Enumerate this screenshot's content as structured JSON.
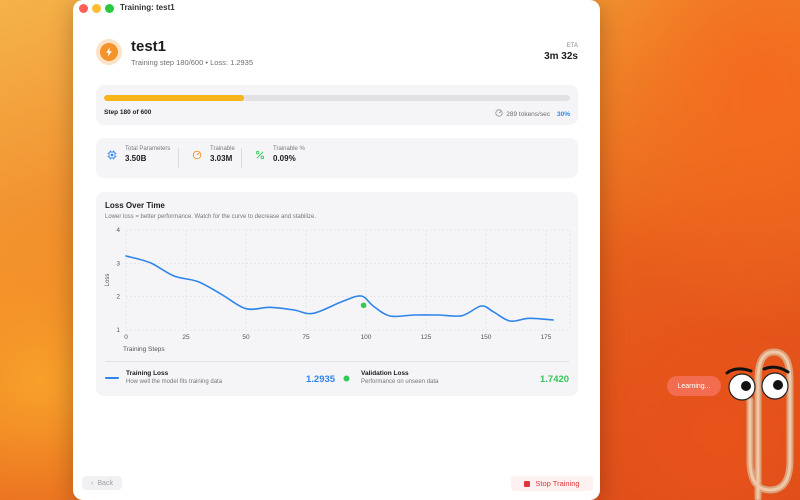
{
  "window": {
    "title": "Training: test1"
  },
  "header": {
    "name": "test1",
    "subtitle": "Training step 180/600 • Loss: 1.2935",
    "eta_label": "ETA",
    "eta_value": "3m 32s",
    "icon": "lightning-bolt-icon"
  },
  "progress": {
    "fraction": 0.3,
    "left_label": "Step 180 of 600",
    "speed": "289 tokens/sec",
    "percent": "30%",
    "fill_color": "#f4b41a",
    "percent_color": "#2f86ea"
  },
  "stats": [
    {
      "label": "Total Parameters",
      "value": "3.50B",
      "icon": "cpu-chip-icon"
    },
    {
      "label": "Trainable",
      "value": "3.03M",
      "icon": "gauge-icon"
    },
    {
      "label": "Trainable %",
      "value": "0.09%",
      "icon": "percent-icon"
    }
  ],
  "chart": {
    "title": "Loss Over Time",
    "subtitle": "Lower loss = better performance. Watch for the curve to decrease and stabilize."
  },
  "chart_data": {
    "type": "line",
    "xlabel": "Training Steps",
    "ylabel": "Loss",
    "xlim": [
      0,
      185
    ],
    "ylim": [
      1,
      4
    ],
    "x_ticks": [
      0,
      25,
      50,
      75,
      100,
      125,
      150,
      175
    ],
    "y_ticks": [
      1,
      2,
      3,
      4
    ],
    "grid": true,
    "series": [
      {
        "name": "Training Loss",
        "color": "#2f86ea",
        "points": [
          [
            0,
            3.22
          ],
          [
            10,
            3.02
          ],
          [
            20,
            2.62
          ],
          [
            30,
            2.45
          ],
          [
            40,
            2.06
          ],
          [
            50,
            1.64
          ],
          [
            60,
            1.68
          ],
          [
            70,
            1.6
          ],
          [
            78,
            1.5
          ],
          [
            90,
            1.85
          ],
          [
            98,
            2.02
          ],
          [
            103,
            1.72
          ],
          [
            110,
            1.42
          ],
          [
            120,
            1.45
          ],
          [
            130,
            1.45
          ],
          [
            140,
            1.43
          ],
          [
            148,
            1.72
          ],
          [
            153,
            1.55
          ],
          [
            160,
            1.27
          ],
          [
            168,
            1.35
          ],
          [
            178,
            1.3
          ]
        ]
      },
      {
        "name": "Validation Loss",
        "color": "#34c759",
        "points": [
          [
            99,
            1.742
          ]
        ]
      }
    ]
  },
  "legend": [
    {
      "name": "Training Loss",
      "desc": "How well the model fits training data",
      "value": "1.2935",
      "color": "#2f86ea"
    },
    {
      "name": "Validation Loss",
      "desc": "Performance on unseen data",
      "value": "1.7420",
      "color": "#34c759"
    }
  ],
  "footer": {
    "back_label": "Back",
    "stop_label": "Stop Training"
  },
  "assistant": {
    "bubble": "Learning..."
  }
}
